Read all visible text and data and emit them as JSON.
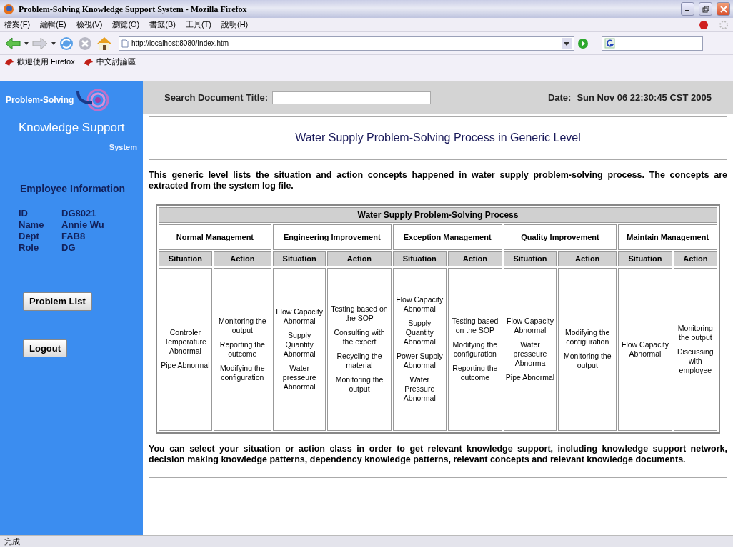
{
  "window": {
    "title": "Problem-Solving Knowledge Support System - Mozilla Firefox"
  },
  "menu": [
    "檔案(F)",
    "編輯(E)",
    "檢視(V)",
    "瀏覽(O)",
    "書籤(B)",
    "工具(T)",
    "說明(H)"
  ],
  "address": {
    "url": "http://localhost:8080/Index.htm"
  },
  "bookmarks": [
    "歡迎使用 Firefox",
    "中文討論區"
  ],
  "sidebar": {
    "brand": "Problem-Solving",
    "subtitle": "Knowledge Support",
    "subtitle_2": "System",
    "info_heading": "Employee Information",
    "fields": [
      {
        "label": "ID",
        "value": "DG8021"
      },
      {
        "label": "Name",
        "value": "Annie Wu"
      },
      {
        "label": "Dept",
        "value": "FAB8"
      },
      {
        "label": "Role",
        "value": "DG"
      }
    ],
    "buttons": [
      "Problem List",
      "Logout"
    ]
  },
  "search": {
    "label": "Search Document Title:"
  },
  "date": {
    "label": "Date:",
    "value": "Sun Nov 06 22:30:45 CST 2005"
  },
  "heading": "Water Supply Problem-Solving Process in Generic Level",
  "intro": "This generic level lists the situation and action concepts happened in water supply problem-solving process. The concepts are extracted from the system log file.",
  "table": {
    "title": "Water Supply Problem-Solving Process",
    "groups": [
      {
        "name": "Normal Management",
        "situation_header": "Situation",
        "action_header": "Action",
        "situations": [
          "Controler Temperature Abnormal",
          "Pipe Abnormal"
        ],
        "actions": [
          "Monitoring the output",
          "Reporting the outcome",
          "Modifying the configuration"
        ]
      },
      {
        "name": "Engineering Improvement",
        "situation_header": "Situation",
        "action_header": "Action",
        "situations": [
          "Flow Capacity Abnormal",
          "Supply Quantity Abnormal",
          "Water presseure Abnormal"
        ],
        "actions": [
          "Testing based on the SOP",
          "Consulting with the expert",
          "Recycling the material",
          "Monitoring the output"
        ]
      },
      {
        "name": "Exception Management",
        "situation_header": "Situation",
        "action_header": "Action",
        "situations": [
          "Flow Capacity Abnormal",
          "Supply Quantity Abnormal",
          "Power Supply Abnormal",
          "Water Pressure Abnormal"
        ],
        "actions": [
          "Testing based on the SOP",
          "Modifying the configuration",
          "Reporting the outcome"
        ]
      },
      {
        "name": "Quality Improvement",
        "situation_header": "Situation",
        "action_header": "Action",
        "situations": [
          "Flow Capacity Abnormal",
          "Water presseure Abnorma",
          "Pipe Abnormal"
        ],
        "actions": [
          "Modifying the configuration",
          "Monitoring the output"
        ]
      },
      {
        "name": "Maintain Management",
        "situation_header": "Situation",
        "action_header": "Action",
        "situations": [
          "Flow Capacity Abnormal"
        ],
        "actions": [
          "Monitoring the output",
          "Discussing with employee"
        ]
      }
    ]
  },
  "footer_text": "You can select your situation or action class in order to get relevant knowledge support, including knowledge support network, decision making knowledge patterns, dependency knowledge patterns, relevant concepts and relevant knowledge documents.",
  "status_bar": "完成"
}
